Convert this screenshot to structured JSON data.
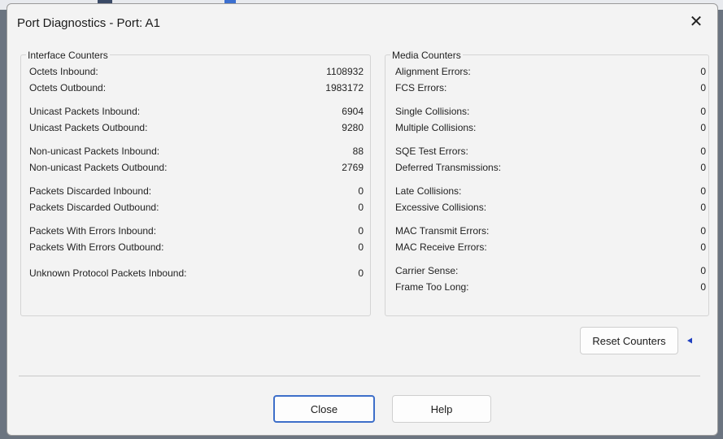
{
  "dialog": {
    "title": "Port Diagnostics - Port: A1",
    "close_glyph": "✕"
  },
  "interface_counters": {
    "label": "Interface Counters",
    "rows": [
      {
        "label": "Octets Inbound:",
        "value": "1108932"
      },
      {
        "label": "Octets Outbound:",
        "value": "1983172"
      },
      {
        "label": "Unicast Packets Inbound:",
        "value": "6904"
      },
      {
        "label": "Unicast Packets Outbound:",
        "value": "9280"
      },
      {
        "label": "Non-unicast Packets Inbound:",
        "value": "88"
      },
      {
        "label": "Non-unicast Packets Outbound:",
        "value": "2769"
      },
      {
        "label": "Packets Discarded Inbound:",
        "value": "0"
      },
      {
        "label": "Packets Discarded Outbound:",
        "value": "0"
      },
      {
        "label": "Packets With Errors Inbound:",
        "value": "0"
      },
      {
        "label": "Packets With Errors Outbound:",
        "value": "0"
      },
      {
        "label": "Unknown Protocol Packets Inbound:",
        "value": "0"
      }
    ]
  },
  "media_counters": {
    "label": "Media Counters",
    "rows": [
      {
        "label": "Alignment Errors:",
        "value": "0"
      },
      {
        "label": "FCS Errors:",
        "value": "0"
      },
      {
        "label": "Single Collisions:",
        "value": "0"
      },
      {
        "label": "Multiple Collisions:",
        "value": "0"
      },
      {
        "label": "SQE Test Errors:",
        "value": "0"
      },
      {
        "label": "Deferred Transmissions:",
        "value": "0"
      },
      {
        "label": "Late Collisions:",
        "value": "0"
      },
      {
        "label": "Excessive Collisions:",
        "value": "0"
      },
      {
        "label": "MAC Transmit Errors:",
        "value": "0"
      },
      {
        "label": "MAC Receive Errors:",
        "value": "0"
      },
      {
        "label": "Carrier Sense:",
        "value": "0"
      },
      {
        "label": "Frame Too Long:",
        "value": "0"
      }
    ]
  },
  "buttons": {
    "reset": "Reset Counters",
    "close": "Close",
    "help": "Help"
  },
  "colors": {
    "accent_border": "#3d6ec9",
    "arrow": "#1f3fbf"
  },
  "icons": {
    "close": "close-icon",
    "pointer": "arrow-left-icon"
  }
}
